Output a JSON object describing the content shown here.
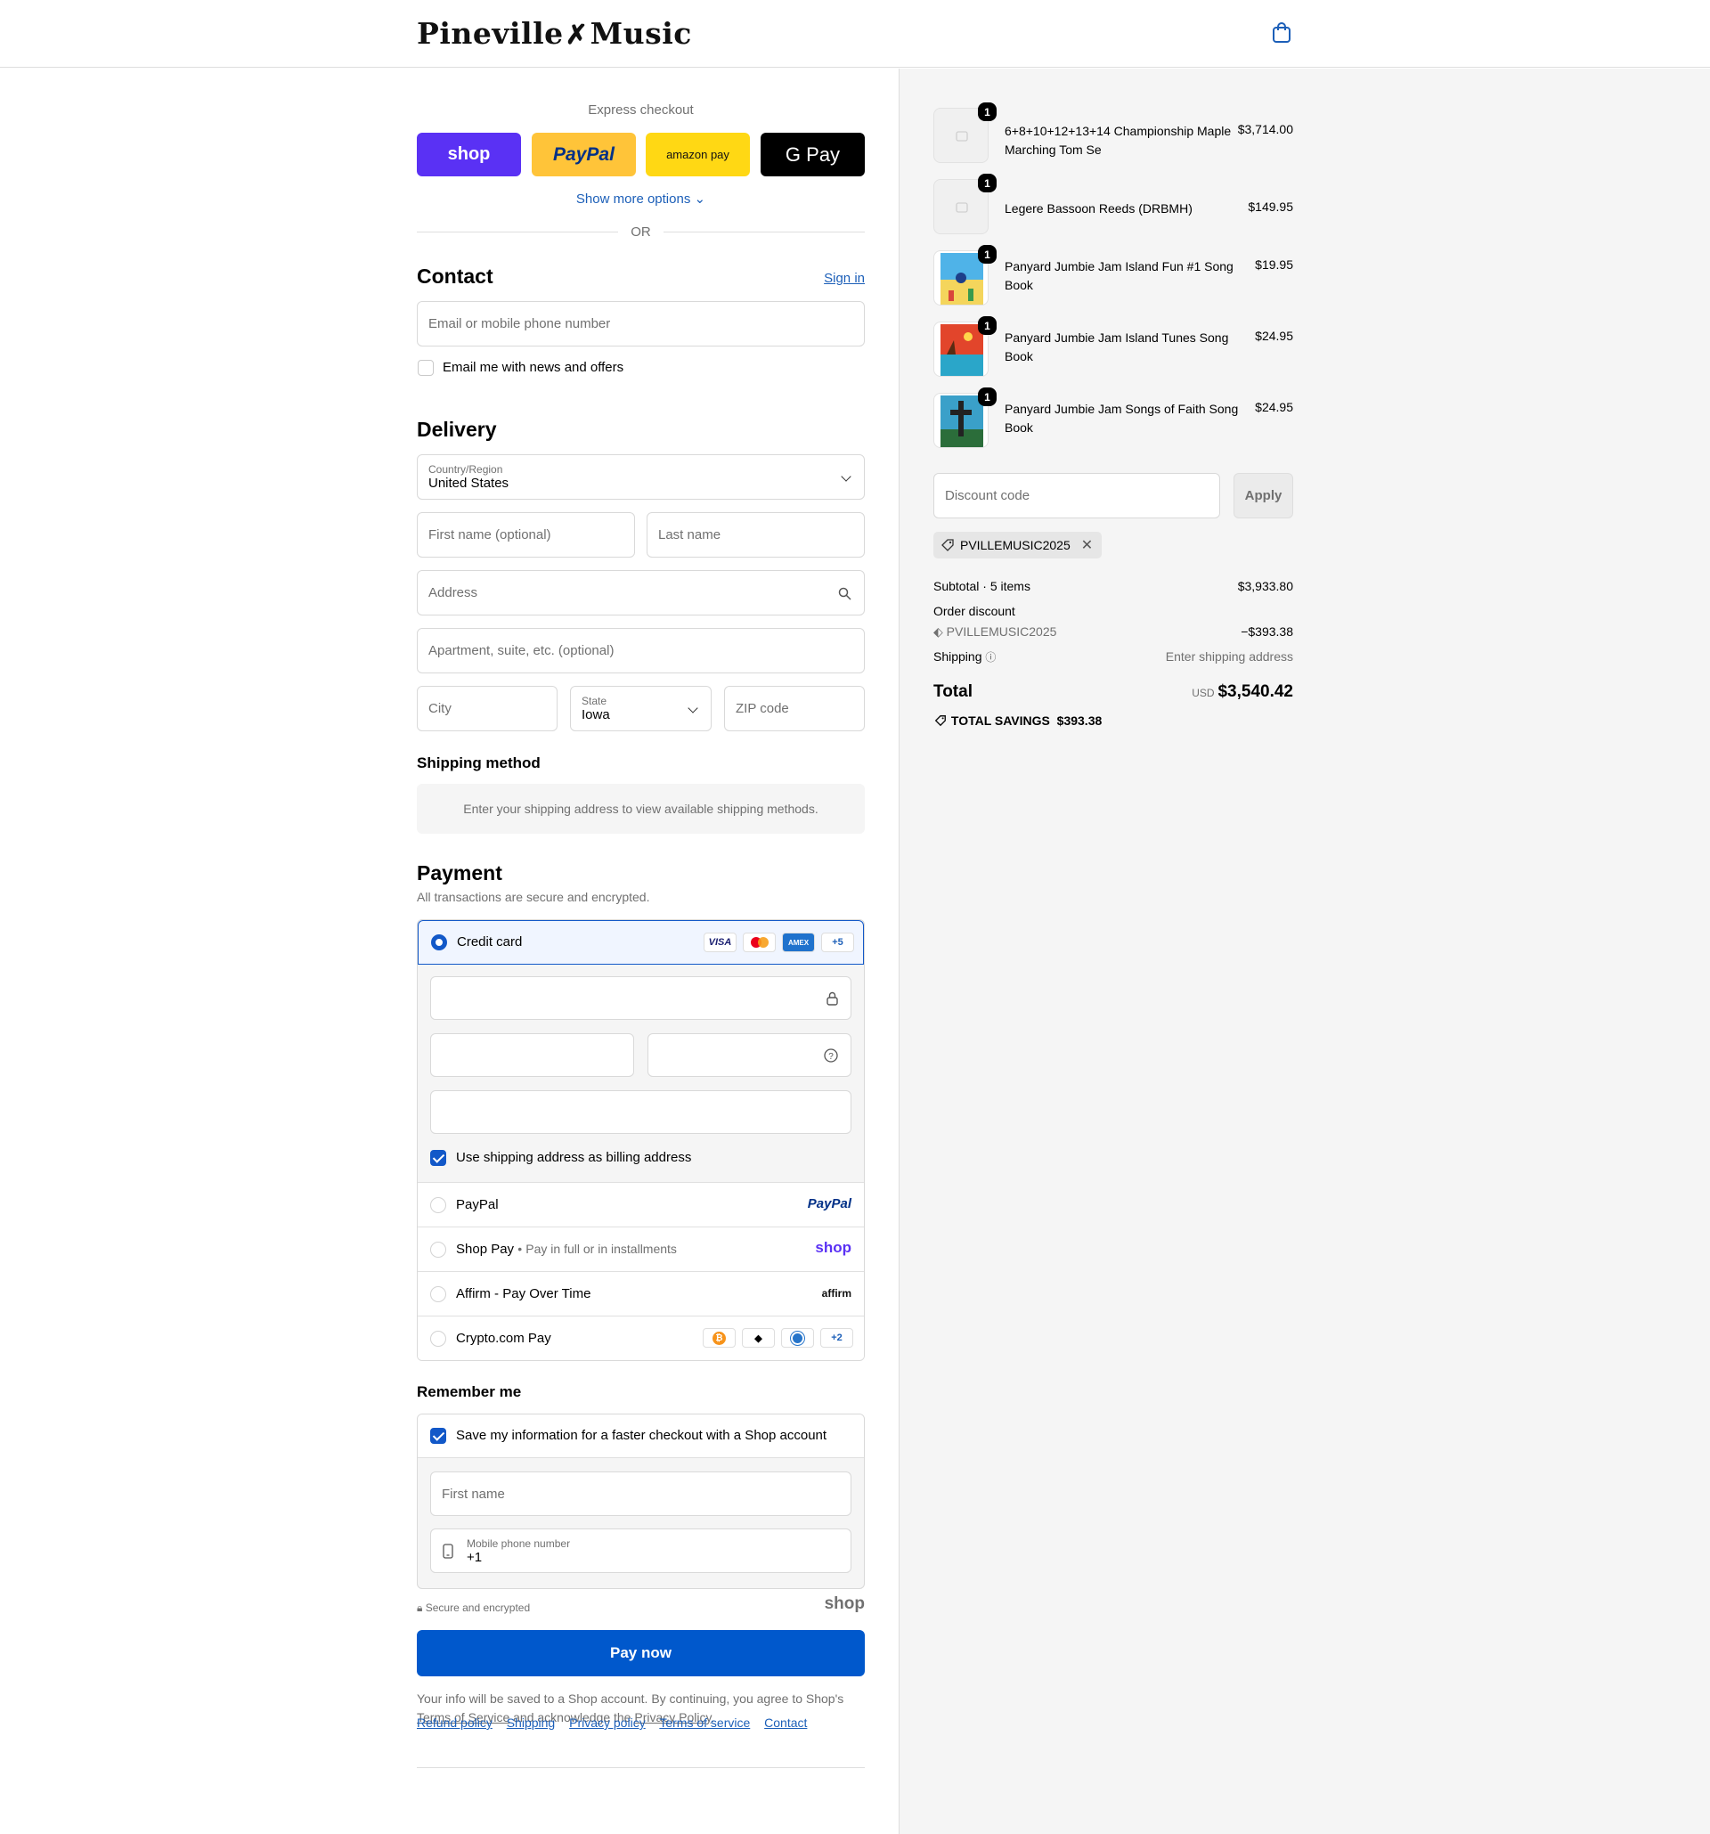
{
  "header": {
    "brand_left": "Pineville",
    "brand_right": "Music",
    "cart_icon": "shopping-bag-icon"
  },
  "express": {
    "title": "Express checkout",
    "buttons": [
      "shop",
      "PayPal",
      "amazon pay",
      "G Pay"
    ],
    "show_more": "Show more options",
    "or": "OR"
  },
  "contact": {
    "title": "Contact",
    "sign_in": "Sign in",
    "email_placeholder": "Email or mobile phone number",
    "newsletter_label": "Email me with news and offers"
  },
  "delivery": {
    "title": "Delivery",
    "country_label": "Country/Region",
    "country_value": "United States",
    "first_name_placeholder": "First name (optional)",
    "last_name_placeholder": "Last name",
    "address_placeholder": "Address",
    "apartment_placeholder": "Apartment, suite, etc. (optional)",
    "city_placeholder": "City",
    "state_label": "State",
    "state_value": "Iowa",
    "zip_placeholder": "ZIP code"
  },
  "shipping_method": {
    "title": "Shipping method",
    "message": "Enter your shipping address to view available shipping methods."
  },
  "payment": {
    "title": "Payment",
    "subtitle": "All transactions are secure and encrypted.",
    "credit_card_label": "Credit card",
    "card_brands": [
      "VISA",
      "MC",
      "AMEX",
      "+5"
    ],
    "billing_same_label": "Use shipping address as billing address",
    "paypal_label": "PayPal",
    "paypal_logo": "PayPal",
    "shoppay_label": "Shop Pay",
    "shoppay_sub": "Pay in full or in installments",
    "shoppay_logo": "shop",
    "affirm_label": "Affirm - Pay Over Time",
    "affirm_logo": "affirm",
    "crypto_label": "Crypto.com Pay",
    "crypto_more": "+2"
  },
  "remember": {
    "title": "Remember me",
    "save_label": "Save my information for a faster checkout with a Shop account",
    "first_name_placeholder": "First name",
    "phone_label": "Mobile phone number",
    "phone_value": "+1",
    "secure_label": "Secure and encrypted",
    "shop_logo": "shop"
  },
  "pay_now": "Pay now",
  "legal": {
    "line1": "Your info will be saved to a Shop account. By continuing, you agree to Shop's",
    "tos": "Terms of Service",
    "mid": "and acknowledge the",
    "privacy": "Privacy Policy",
    "end": "."
  },
  "footer": [
    "Refund policy",
    "Shipping",
    "Privacy policy",
    "Terms of service",
    "Contact"
  ],
  "cart": {
    "items": [
      {
        "name": "6+8+10+12+13+14 Championship Maple Marching Tom Se",
        "price": "$3,714.00",
        "qty": "1"
      },
      {
        "name": "Legere Bassoon Reeds (DRBMH)",
        "price": "$149.95",
        "qty": "1"
      },
      {
        "name": "Panyard Jumbie Jam Island Fun #1 Song Book",
        "price": "$19.95",
        "qty": "1"
      },
      {
        "name": "Panyard Jumbie Jam Island Tunes Song Book",
        "price": "$24.95",
        "qty": "1"
      },
      {
        "name": "Panyard Jumbie Jam Songs of Faith Song Book",
        "price": "$24.95",
        "qty": "1"
      }
    ],
    "discount_placeholder": "Discount code",
    "apply": "Apply",
    "applied_code": "PVILLEMUSIC2025",
    "subtotal_label": "Subtotal · 5 items",
    "subtotal_value": "$3,933.80",
    "order_discount_label": "Order discount",
    "discount_code": "PVILLEMUSIC2025",
    "discount_value": "−$393.38",
    "shipping_label": "Shipping",
    "shipping_value": "Enter shipping address",
    "total_label": "Total",
    "currency": "USD",
    "total_value": "$3,540.42",
    "savings_label": "TOTAL SAVINGS",
    "savings_value": "$393.38"
  }
}
